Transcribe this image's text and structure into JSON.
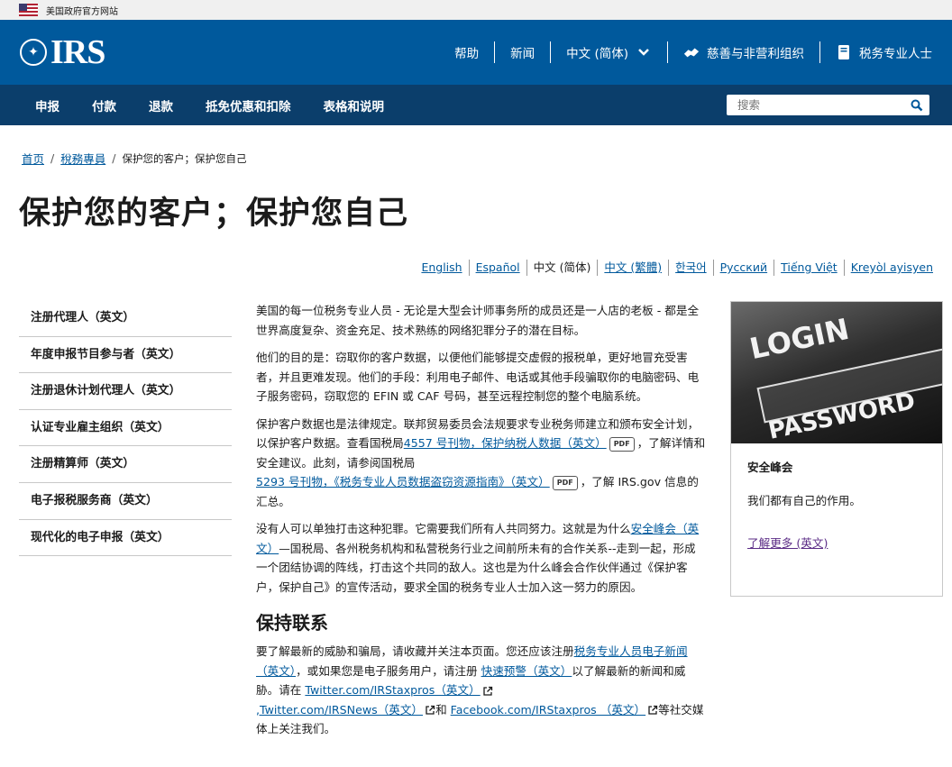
{
  "gov_banner": {
    "text": "美国政府官方网站"
  },
  "header": {
    "logo_text": "IRS",
    "links": [
      {
        "label": "帮助"
      },
      {
        "label": "新闻"
      },
      {
        "label": "中文 (简体)"
      },
      {
        "label": "慈善与非营利组织"
      },
      {
        "label": "税务专业人士"
      }
    ]
  },
  "mainnav": {
    "items": [
      {
        "label": "申报"
      },
      {
        "label": "付款"
      },
      {
        "label": "退款"
      },
      {
        "label": "抵免优惠和扣除"
      },
      {
        "label": "表格和说明"
      }
    ],
    "search_placeholder": "搜索"
  },
  "breadcrumb": {
    "home": "首页",
    "section": "稅務專員",
    "current": "保护您的客户；保护您自己"
  },
  "page_title": "保护您的客户；保护您自己",
  "languages": [
    {
      "label": "English"
    },
    {
      "label": "Español"
    },
    {
      "label": "中文 (简体)"
    },
    {
      "label": "中文 (繁體)"
    },
    {
      "label": "한국어"
    },
    {
      "label": "Русский"
    },
    {
      "label": "Tiếng Việt"
    },
    {
      "label": "Kreyòl ayisyen"
    }
  ],
  "sidebar": {
    "items": [
      {
        "label": "注册代理人（英文）"
      },
      {
        "label": "年度申报节目参与者（英文）"
      },
      {
        "label": "注册退休计划代理人（英文）"
      },
      {
        "label": "认证专业雇主组织（英文）"
      },
      {
        "label": "注册精算师（英文）"
      },
      {
        "label": "电子报税服务商（英文）"
      },
      {
        "label": "现代化的电子申报（英文）"
      }
    ]
  },
  "content": {
    "p1": "美国的每一位税务专业人员 - 无论是大型会计师事务所的成员还是一人店的老板 - 都是全世界高度复杂、资金充足、技术熟练的网络犯罪分子的潜在目标。",
    "p2": "他们的目的是：窃取你的客户数据，以便他们能够提交虚假的报税单，更好地冒充受害者，并且更难发现。他们的手段：利用电子邮件、电话或其他手段骗取你的电脑密码、电子服务密码，窃取您的 EFIN 或 CAF 号码，甚至远程控制您的整个电脑系统。",
    "p3_a": "保护客户数据也是法律规定。联邦贸易委员会法规要求专业税务师建立和颁布安全计划，以保护客户数据。查看国税局",
    "p3_link1": "4557 号刊物，保护纳税人数据（英文）",
    "p3_pdf": "PDF",
    "p3_b": "，了解详情和安全建议。此刻，请参阅国税局",
    "p3_link2": "5293 号刊物，《税务专业人员数据盗窃资源指南》（英文）",
    "p3_c": "，了解 IRS.gov 信息的汇总。",
    "p4_a": "没有人可以单独打击这种犯罪。它需要我们所有人共同努力。这就是为什么",
    "p4_link": "安全峰会（英文）",
    "p4_b": "—国税局、各州税务机构和私营税务行业之间前所未有的合作关系--走到一起，形成一个团结协调的阵线，打击这个共同的敌人。这也是为什么峰会合作伙伴通过《保护客户，保护自己》的宣传活动，要求全国的税务专业人士加入这一努力的原因。",
    "h2": "保持联系",
    "p5_a": "要了解最新的威胁和骗局，请收藏并关注本页面。您还应该注册",
    "p5_link1": "税务专业人员电子新闻（英文）",
    "p5_b": "，或如果您是电子服务用户，请注册 ",
    "p5_link2": "快速预警（英文）",
    "p5_c": "以了解最新的新闻和威胁。请在 ",
    "p5_link3": "Twitter.com/IRStaxpros（英文）",
    "p5_link4": ",Twitter.com/IRSNews（英文）",
    "p5_d": "和 ",
    "p5_link5": "Facebook.com/IRStaxpros （英文）",
    "p5_e": "等社交媒体上关注我们。"
  },
  "card": {
    "image_text_1": "LOGIN",
    "image_text_2": "PASSWORD",
    "title": "安全峰会",
    "text": "我们都有自己的作用。",
    "link": "了解更多 (英文)"
  }
}
